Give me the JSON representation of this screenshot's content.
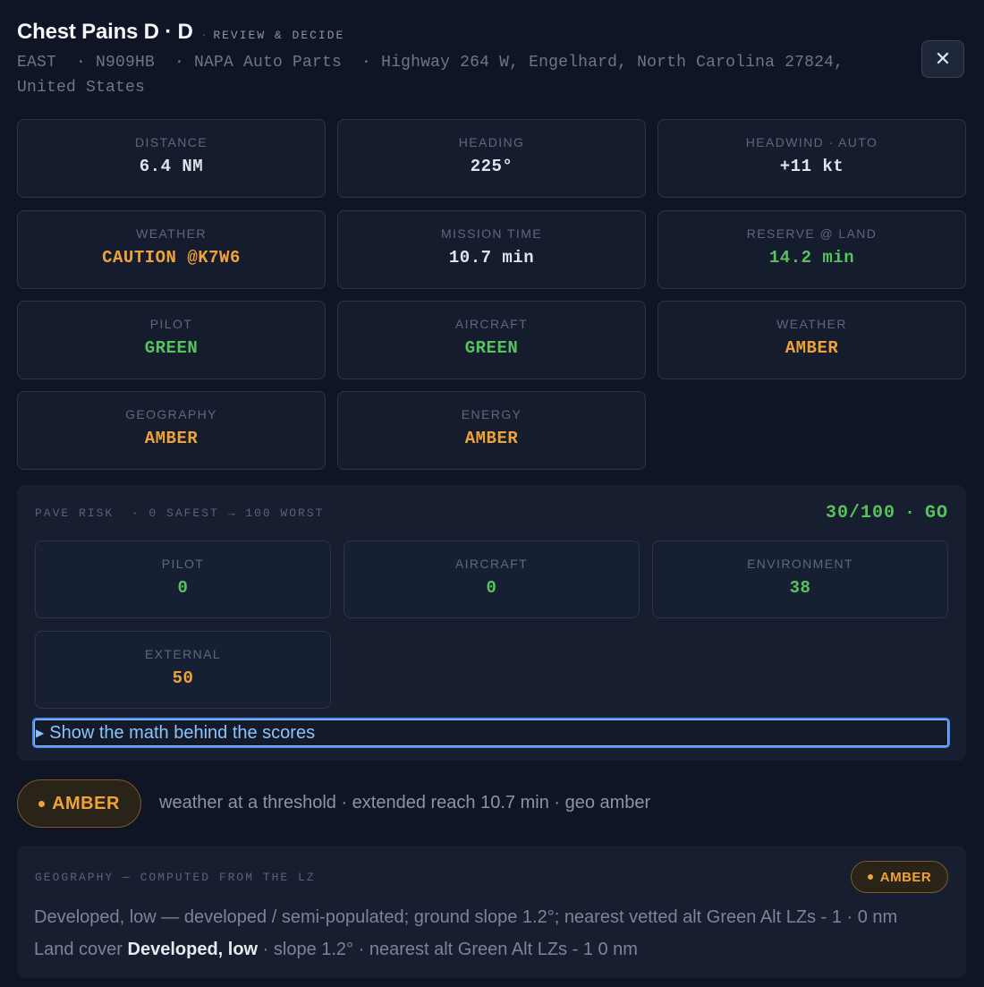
{
  "header": {
    "title": "Chest Pains D · D",
    "subtitle": "REVIEW & DECIDE",
    "meta_line1": "EAST  · N909HB  · NAPA Auto Parts  · Highway 264 W, Engelhard, North Carolina 27824,",
    "meta_line2": "United States",
    "close_icon": "✕"
  },
  "metrics": [
    {
      "label": "DISTANCE",
      "value": "6.4 NM",
      "color": "#dfe4ec"
    },
    {
      "label": "HEADING",
      "value": "225°",
      "color": "#dfe4ec"
    },
    {
      "label": "HEADWIND · AUTO",
      "value": "+11 kt",
      "color": "#dfe4ec"
    },
    {
      "label": "WEATHER",
      "value": "CAUTION @K7W6",
      "color": "#f0a23a"
    },
    {
      "label": "MISSION TIME",
      "value": "10.7 min",
      "color": "#dfe4ec"
    },
    {
      "label": "RESERVE @ LAND",
      "value": "14.2 min",
      "color": "#56c35d"
    },
    {
      "label": "PILOT",
      "value": "GREEN",
      "color": "#56c35d"
    },
    {
      "label": "AIRCRAFT",
      "value": "GREEN",
      "color": "#56c35d"
    },
    {
      "label": "WEATHER",
      "value": "AMBER",
      "color": "#f0a23a"
    },
    {
      "label": "GEOGRAPHY",
      "value": "AMBER",
      "color": "#f0a23a"
    },
    {
      "label": "ENERGY",
      "value": "AMBER",
      "color": "#f0a23a"
    }
  ],
  "pave": {
    "label": "PAVE RISK  · 0 SAFEST → 100 WORST",
    "score": "30/100",
    "sep": "·",
    "verdict": "GO",
    "items": [
      {
        "label": "PILOT",
        "value": "0",
        "color": "#56c35d"
      },
      {
        "label": "AIRCRAFT",
        "value": "0",
        "color": "#56c35d"
      },
      {
        "label": "ENVIRONMENT",
        "value": "38",
        "color": "#56c35d"
      },
      {
        "label": "EXTERNAL",
        "value": "50",
        "color": "#f0a23a"
      }
    ],
    "math_label": "Show the math behind the scores"
  },
  "decision": {
    "badge": "AMBER",
    "reason": "weather at a threshold · extended reach 10.7 min · geo amber"
  },
  "geography": {
    "label": "GEOGRAPHY — COMPUTED FROM THE LZ",
    "badge": "AMBER",
    "line1": "Developed, low — developed / semi-populated; ground slope 1.2°; nearest vetted alt Green Alt LZs - 1 · 0 nm",
    "line2_prefix": "Land cover ",
    "line2_bold": "Developed, low",
    "line2_suffix": " · slope 1.2° · nearest alt Green Alt LZs - 1 0 nm"
  }
}
